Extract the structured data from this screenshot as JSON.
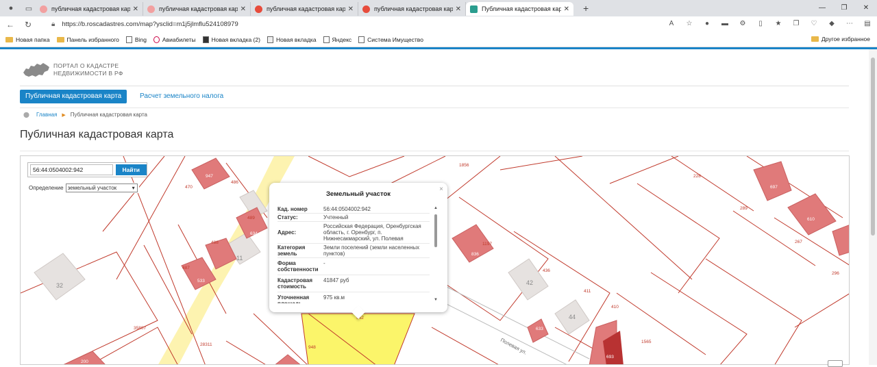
{
  "browser": {
    "tabs": [
      {
        "title": "публичная кадастровая карта и",
        "icon": "yandex-search-favicon"
      },
      {
        "title": "публичная кадастровая карта —",
        "icon": "yandex-search-favicon"
      },
      {
        "title": "публичная кадастровая карта —",
        "icon": "yandex-favicon"
      },
      {
        "title": "публичная кадастровая карта —",
        "icon": "yandex-favicon"
      },
      {
        "title": "Публичная кадастровая карта",
        "icon": "rosreestr-favicon",
        "active": true
      }
    ],
    "url": "https://b.roscadastres.com/map?ysclid=m1j5jlmflu524108979",
    "bookmarks": [
      "Новая папка",
      "Панель избранного",
      "Bing",
      "Авиабилеты",
      "Новая вкладка (2)",
      "Новая вкладка",
      "Яндекс",
      "Система Имущество"
    ],
    "other_bookmarks": "Другое избранное"
  },
  "site": {
    "logo_line1": "ПОРТАЛ О КАДАСТРЕ",
    "logo_line2": "НЕДВИЖИМОСТИ В РФ",
    "menu_active": "Публичная кадастровая карта",
    "menu_link": "Расчет земельного налога",
    "crumb_home": "Главная",
    "crumb_current": "Публичная кадастровая карта",
    "page_title": "Публичная кадастровая карта"
  },
  "search": {
    "value": "56:44:0504002:942",
    "button": "Найти",
    "def_label": "Определение",
    "def_value": "земельный участок"
  },
  "popup": {
    "title": "Земельный участок",
    "close": "×",
    "rows": [
      {
        "k": "Кад. номер",
        "v": "56:44:0504002:942"
      },
      {
        "k": "Статус:",
        "v": "Учтенный"
      },
      {
        "k": "Адрес:",
        "v": "Российская Федерация, Оренбургская область, г. Оренбург, п. Нижнесакмарский, ул. Полевая"
      },
      {
        "k": "Категория земель",
        "v": "Земли поселений (земли населенных пунктов)"
      },
      {
        "k": "Форма собственности",
        "v": "-"
      },
      {
        "k": "Кадастровая стоимость",
        "v": "41847 руб"
      },
      {
        "k": "Уточненная площадь",
        "v": "975 кв.м"
      }
    ]
  },
  "map": {
    "labels": [
      "1856",
      "228",
      "289",
      "267",
      "296",
      "470",
      "486",
      "489",
      "488",
      "487",
      "11",
      "32",
      "35807",
      "28311",
      "948",
      "1197",
      "436",
      "42",
      "411",
      "410",
      "44",
      "1565",
      "634",
      "942",
      "697",
      "610",
      "836",
      "633",
      "693",
      "200",
      "947",
      "533"
    ],
    "street": "Полевая ул.",
    "colors": {
      "parcel_line": "#c0392b",
      "building": "#e07a7a",
      "selected": "#fbf56a",
      "road": "#fdf3b0"
    }
  }
}
